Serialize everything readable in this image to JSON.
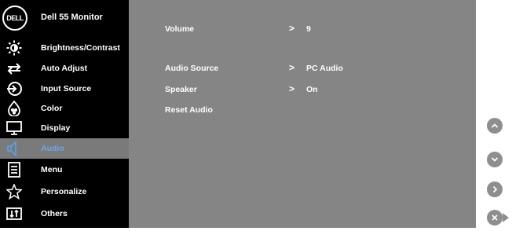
{
  "header": {
    "logo_text": "DELL",
    "model": "Dell 55 Monitor"
  },
  "sidebar": {
    "items": [
      {
        "label": "Brightness/Contrast",
        "icon": "brightness-icon"
      },
      {
        "label": "Auto Adjust",
        "icon": "auto-adjust-icon"
      },
      {
        "label": "Input Source",
        "icon": "input-source-icon"
      },
      {
        "label": "Color",
        "icon": "color-icon"
      },
      {
        "label": "Display",
        "icon": "display-icon"
      },
      {
        "label": "Audio",
        "icon": "audio-icon",
        "selected": true
      },
      {
        "label": "Menu",
        "icon": "menu-icon"
      },
      {
        "label": "Personalize",
        "icon": "personalize-icon"
      },
      {
        "label": "Others",
        "icon": "others-icon"
      }
    ]
  },
  "audio": {
    "volume_label": "Volume",
    "volume_value": "9",
    "source_label": "Audio Source",
    "source_value": "PC Audio",
    "speaker_label": "Speaker",
    "speaker_value": "On",
    "reset_label": "Reset Audio"
  },
  "buttons": [
    "up-button",
    "down-button",
    "right-button",
    "close-button"
  ],
  "colors": {
    "selected_text": "#6aa9e8",
    "content_bg": "#858585",
    "sidebar_bg": "#000000",
    "selected_bg": "#7a7a7a"
  }
}
